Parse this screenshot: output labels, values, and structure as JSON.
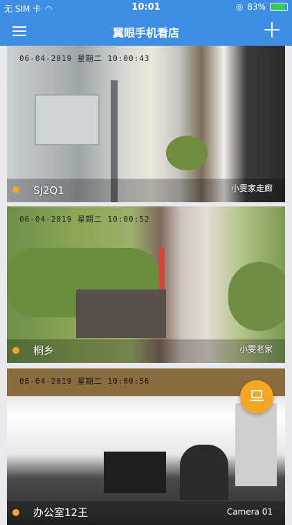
{
  "status": {
    "carrier": "无 SIM 卡",
    "time": "10:01",
    "battery_pct": "83%",
    "battery_level": 0.83
  },
  "header": {
    "title": "翼眼手机看店"
  },
  "cameras": [
    {
      "name": "SJ2Q1",
      "timestamp": "06-04-2019 星期二 10:00:43",
      "location": "小雯家走廊"
    },
    {
      "name": "桐乡",
      "timestamp": "06-04-2019 星期二 10:00:52",
      "location": "小雯老家"
    },
    {
      "name": "办公室12王",
      "timestamp": "06-04-2019 星期二 10:00:56",
      "location": "Camera 01"
    }
  ],
  "icons": {
    "menu": "hamburger-icon",
    "add": "plus-icon",
    "fab": "screen-icon",
    "status_dot": "dot-icon"
  },
  "colors": {
    "navbar": "#3f8ee6",
    "accent": "#f5a623"
  }
}
